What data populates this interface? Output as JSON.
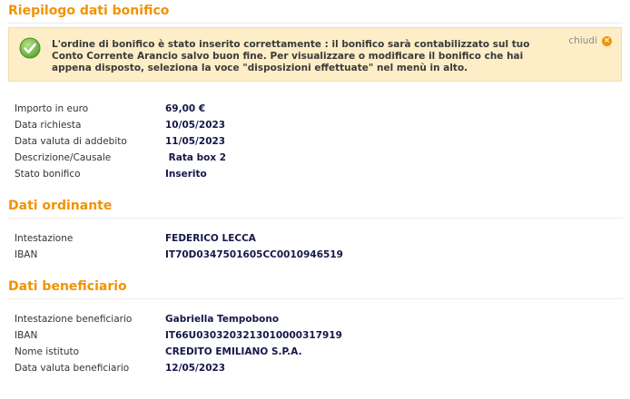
{
  "summary": {
    "title": "Riepilogo dati bonifico",
    "notice": "L'ordine di bonifico è stato inserito correttamente : il bonifico sarà contabilizzato sul tuo Conto Corrente Arancio salvo buon fine. Per visualizzare o modificare il bonifico che hai appena disposto, seleziona la voce \"disposizioni effettuate\" nel menù in alto.",
    "close_label": "chiudi",
    "rows": [
      {
        "label": "Importo in euro",
        "value": "69,00 €"
      },
      {
        "label": "Data richiesta",
        "value": "10/05/2023"
      },
      {
        "label": "Data valuta di addebito",
        "value": "11/05/2023"
      },
      {
        "label": "Descrizione/Causale",
        "value": " Rata box 2"
      },
      {
        "label": "Stato bonifico",
        "value": "Inserito"
      }
    ]
  },
  "ordinante": {
    "title": "Dati ordinante",
    "rows": [
      {
        "label": "Intestazione",
        "value": "FEDERICO LECCA"
      },
      {
        "label": "IBAN",
        "value": "IT70D0347501605CC0010946519"
      }
    ]
  },
  "beneficiario": {
    "title": "Dati beneficiario",
    "rows": [
      {
        "label": "Intestazione beneficiario",
        "value": "Gabriella Tempobono"
      },
      {
        "label": "IBAN",
        "value": "IT66U0303203213010000317919"
      },
      {
        "label": "Nome istituto",
        "value": "CREDITO EMILIANO S.P.A."
      },
      {
        "label": "Data valuta beneficiario",
        "value": "12/05/2023"
      }
    ]
  },
  "colors": {
    "accent": "#f39200",
    "notice_bg": "#fdeec7",
    "value_text": "#15174a",
    "success_icon": "#6fb43f"
  },
  "icons": {
    "success": "checkmark-circle-icon",
    "close": "close-circle-icon"
  }
}
